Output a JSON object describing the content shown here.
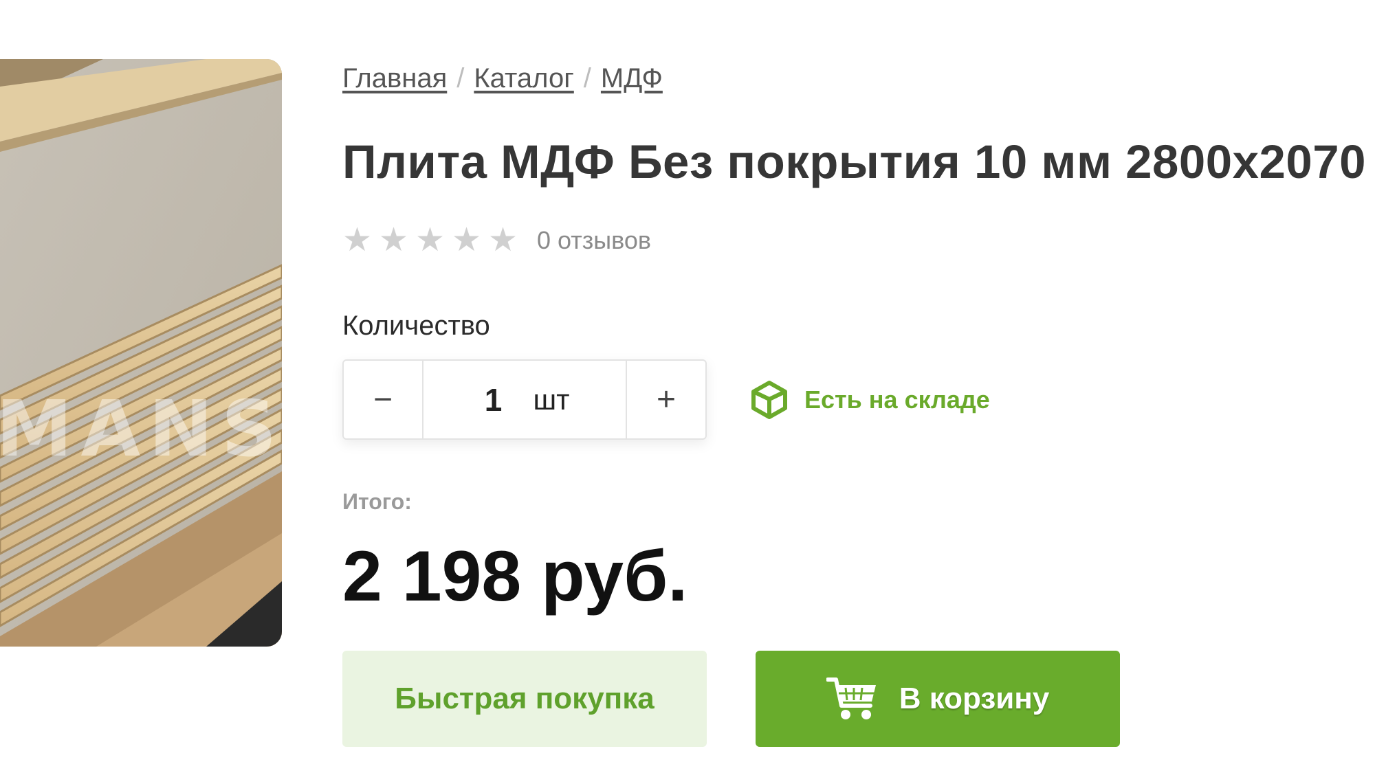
{
  "product_image": {
    "watermark": "MANS"
  },
  "breadcrumb": [
    {
      "label": "Главная"
    },
    {
      "label": "Каталог"
    },
    {
      "label": "МДФ"
    }
  ],
  "breadcrumb_separator": "/",
  "title": "Плита МДФ Без покрытия 10 мм 2800х2070",
  "rating": {
    "value": 0,
    "max": 5,
    "star_glyph": "★",
    "reviews_text": "0 отзывов"
  },
  "quantity": {
    "label": "Количество",
    "minus": "−",
    "plus": "+",
    "value": "1",
    "unit": "шт"
  },
  "stock": {
    "text": "Есть на складе",
    "icon": "box-icon",
    "color": "#6aaa2b"
  },
  "total": {
    "label": "Итого:",
    "value": "2 198 руб."
  },
  "buttons": {
    "quick_buy": "Быстрая покупка",
    "add_to_cart": "В корзину",
    "cart_icon": "cart-icon"
  },
  "colors": {
    "accent": "#69ac2c",
    "accent_light": "#eaf4e1",
    "star_inactive": "#d0d0d0"
  }
}
